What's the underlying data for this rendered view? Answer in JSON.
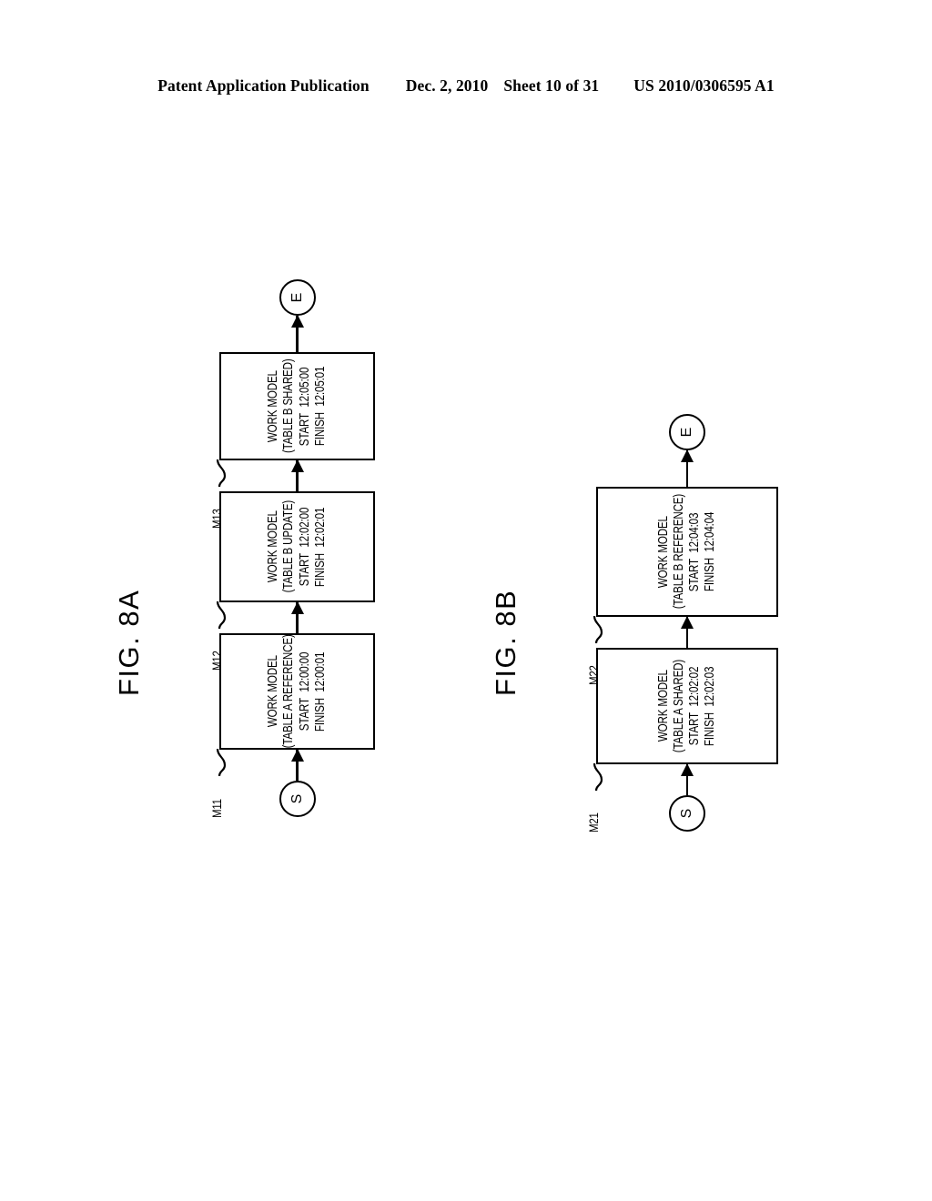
{
  "header": {
    "publication": "Patent Application Publication",
    "date": "Dec. 2, 2010",
    "sheet": "Sheet 10 of 31",
    "patent_number": "US 2010/0306595 A1"
  },
  "figures": [
    {
      "caption": "FIG. 8A",
      "start_terminal": "S",
      "end_terminal": "E",
      "nodes": [
        {
          "ref": "M11",
          "title": "WORK MODEL",
          "subtitle": "(TABLE A REFERENCE)",
          "start_label": "START",
          "start_time": "12:00:00",
          "finish_label": "FINISH",
          "finish_time": "12:00:01"
        },
        {
          "ref": "M12",
          "title": "WORK MODEL",
          "subtitle": "(TABLE B UPDATE)",
          "start_label": "START",
          "start_time": "12:02:00",
          "finish_label": "FINISH",
          "finish_time": "12:02:01"
        },
        {
          "ref": "M13",
          "title": "WORK MODEL",
          "subtitle": "(TABLE B SHARED)",
          "start_label": "START",
          "start_time": "12:05:00",
          "finish_label": "FINISH",
          "finish_time": "12:05:01"
        }
      ]
    },
    {
      "caption": "FIG. 8B",
      "start_terminal": "S",
      "end_terminal": "E",
      "nodes": [
        {
          "ref": "M21",
          "title": "WORK MODEL",
          "subtitle": "(TABLE A SHARED)",
          "start_label": "START",
          "start_time": "12:02:02",
          "finish_label": "FINISH",
          "finish_time": "12:02:03"
        },
        {
          "ref": "M22",
          "title": "WORK MODEL",
          "subtitle": "(TABLE B REFERENCE)",
          "start_label": "START",
          "start_time": "12:04:03",
          "finish_label": "FINISH",
          "finish_time": "12:04:04"
        }
      ]
    }
  ],
  "colors": {
    "ink": "#000000",
    "page": "#ffffff"
  }
}
